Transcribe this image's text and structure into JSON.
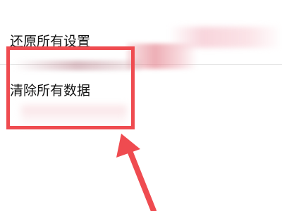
{
  "settings": {
    "items": [
      {
        "label": "还原所有设置"
      },
      {
        "label": "清除所有数据"
      }
    ]
  },
  "annotation": {
    "highlight_color": "#ef4b50",
    "arrow_icon": "up-arrow-icon"
  }
}
